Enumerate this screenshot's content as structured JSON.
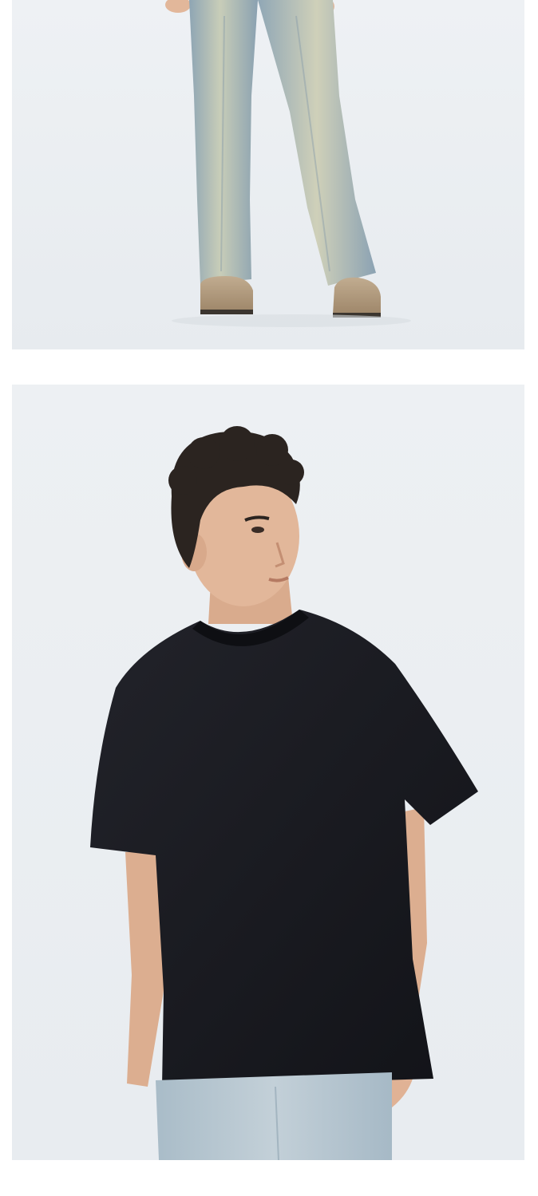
{
  "photos": [
    {
      "id": "jeans-legs-photo",
      "subject": "model-lower-body",
      "colors": {
        "backdrop": "#eef1f4",
        "denim": "#9fb2bf",
        "denim_light": "#c9cfbd",
        "shoe": "#b59f82"
      }
    },
    {
      "id": "model-tshirt-photo",
      "subject": "model-upper-body",
      "colors": {
        "backdrop": "#eceff2",
        "shirt": "#16171c",
        "skin": "#e2b79a",
        "hair": "#2b2420",
        "denim": "#b3c4cf"
      }
    }
  ]
}
